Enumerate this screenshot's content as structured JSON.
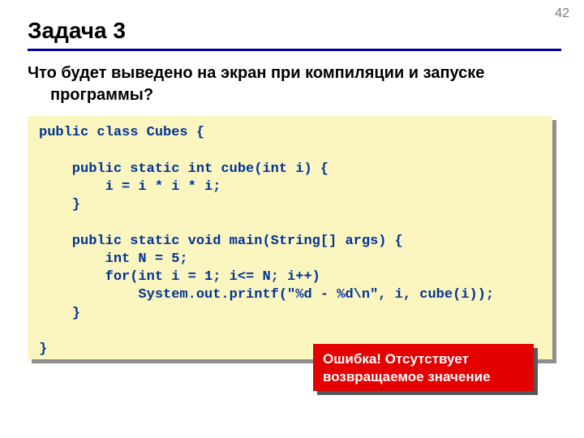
{
  "page_number": "42",
  "title": "Задача 3",
  "question_line1": "Что будет выведено на экран при компиляции и запуске",
  "question_line2": "программы?",
  "code": "public class Cubes {\n\n    public static int cube(int i) {\n        i = i * i * i;\n    }\n\n    public static void main(String[] args) {\n        int N = 5;\n        for(int i = 1; i<= N; i++)\n            System.out.printf(\"%d - %d\\n\", i, cube(i));\n    }\n\n}",
  "error_line1": "Ошибка! Отсутствует",
  "error_line2": "возвращаемое значение"
}
